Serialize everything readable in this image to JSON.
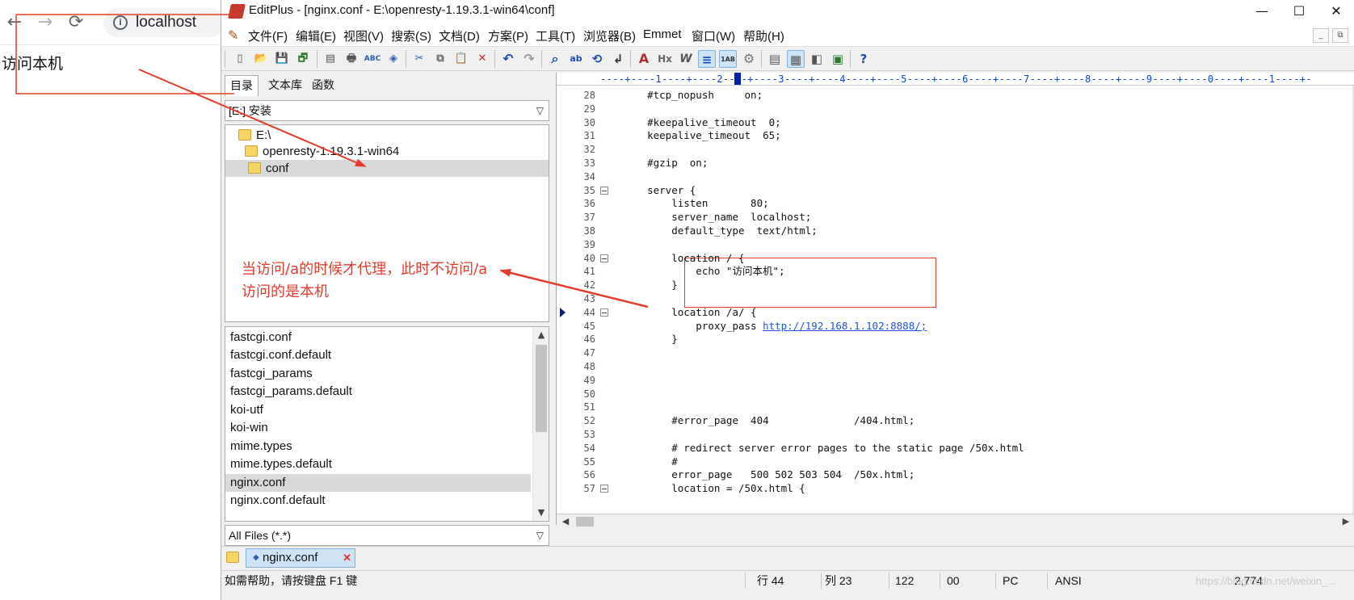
{
  "browser": {
    "back_icon": "←",
    "forward_icon": "→",
    "reload_icon": "⟳",
    "info_icon": "i",
    "url": "localhost",
    "content": "访问本机"
  },
  "window": {
    "title": "EditPlus - [nginx.conf - E:\\openresty-1.19.3.1-win64\\conf]",
    "minimize": "—",
    "maximize": "☐",
    "close": "✕"
  },
  "menu": {
    "pen_icon": "✎",
    "items": [
      "文件(F)",
      "编辑(E)",
      "视图(V)",
      "搜索(S)",
      "文档(D)",
      "方案(P)",
      "工具(T)",
      "浏览器(B)",
      "Emmet",
      "窗口(W)",
      "帮助(H)"
    ],
    "mdi_min": "_",
    "mdi_restore": "⧉"
  },
  "toolbar": {
    "icons": [
      "new-file-icon",
      "open-file-icon",
      "save-icon",
      "save-all-icon",
      "print-preview-icon",
      "print-icon",
      "spellcheck-icon",
      "html-toolbar-icon",
      "cut-icon",
      "copy-icon",
      "paste-icon",
      "delete-icon",
      "undo-icon",
      "redo-icon",
      "find-icon",
      "replace-icon",
      "find-in-files-icon",
      "goto-line-icon",
      "font-icon",
      "hx-icon",
      "word-wrap-icon",
      "indent-icon",
      "line-number-icon",
      "settings-icon",
      "panel-icon",
      "directory-icon",
      "preview-icon",
      "output-icon",
      "help-icon"
    ],
    "glyphs": [
      "▯",
      "📂",
      "💾",
      "🗗",
      "▤",
      "🖶",
      "ABC",
      "◈",
      "✂",
      "⧉",
      "📋",
      "✕",
      "↶",
      "↷",
      "⌕",
      "ab",
      "⟲",
      "↲",
      "A",
      "Hx",
      "W",
      "≡",
      "1AB",
      "⚙",
      "▤",
      "▦",
      "◧",
      "▣",
      "?"
    ]
  },
  "left_panel": {
    "tabs": [
      "目录",
      "文本库",
      "函数"
    ],
    "active_tab": "目录",
    "drive": "[E:] 安装",
    "tree": [
      {
        "label": "E:\\",
        "indent": 0
      },
      {
        "label": "openresty-1.19.3.1-win64",
        "indent": 1
      },
      {
        "label": "conf",
        "indent": 2,
        "selected": true
      }
    ],
    "annotation_line1": "当访问/a的时候才代理，此时不访问/a",
    "annotation_line2": "访问的是本机",
    "files": [
      "fastcgi.conf",
      "fastcgi.conf.default",
      "fastcgi_params",
      "fastcgi_params.default",
      "koi-utf",
      "koi-win",
      "mime.types",
      "mime.types.default",
      "nginx.conf",
      "nginx.conf.default"
    ],
    "selected_file": "nginx.conf",
    "filter": "All Files (*.*)"
  },
  "editor": {
    "ruler": "----+----1----+----2----+----3----+----4----+----5----+----6----+----7----+----8----+----9----+----0----+----1----+-",
    "current_line": 44,
    "lines": [
      {
        "n": "28",
        "t": "    #tcp_nopush     on;"
      },
      {
        "n": "29",
        "t": ""
      },
      {
        "n": "30",
        "t": "    #keepalive_timeout  0;"
      },
      {
        "n": "31",
        "t": "    keepalive_timeout  65;"
      },
      {
        "n": "32",
        "t": ""
      },
      {
        "n": "33",
        "t": "    #gzip  on;"
      },
      {
        "n": "34",
        "t": ""
      },
      {
        "n": "35",
        "t": "    server {",
        "fold": true
      },
      {
        "n": "36",
        "t": "        listen       80;"
      },
      {
        "n": "37",
        "t": "        server_name  localhost;"
      },
      {
        "n": "38",
        "t": "        default_type  text/html;"
      },
      {
        "n": "39",
        "t": ""
      },
      {
        "n": "40",
        "t": "        location / {",
        "fold": true
      },
      {
        "n": "41",
        "t": "            echo \"访问本机\";"
      },
      {
        "n": "42",
        "t": "        }"
      },
      {
        "n": "43",
        "t": ""
      },
      {
        "n": "44",
        "t": "        location /a/ {",
        "fold": true,
        "marker": true
      },
      {
        "n": "45",
        "t": "            proxy_pass ",
        "link": "http://192.168.1.102:8888/;"
      },
      {
        "n": "46",
        "t": "        }"
      },
      {
        "n": "47",
        "t": ""
      },
      {
        "n": "48",
        "t": ""
      },
      {
        "n": "49",
        "t": ""
      },
      {
        "n": "50",
        "t": ""
      },
      {
        "n": "51",
        "t": ""
      },
      {
        "n": "52",
        "t": "        #error_page  404              /404.html;"
      },
      {
        "n": "53",
        "t": ""
      },
      {
        "n": "54",
        "t": "        # redirect server error pages to the static page /50x.html"
      },
      {
        "n": "55",
        "t": "        #"
      },
      {
        "n": "56",
        "t": "        error_page   500 502 503 504  /50x.html;"
      },
      {
        "n": "57",
        "t": "        location = /50x.html {",
        "fold": true
      }
    ]
  },
  "doc_tabs": {
    "items": [
      {
        "label": "nginx.conf",
        "active": true
      }
    ],
    "close_icon": "✕"
  },
  "status": {
    "help": "如需帮助，请按键盘 F1 键",
    "line": "行 44",
    "col": "列 23",
    "total": "122",
    "sel": "00",
    "mode": "PC",
    "encoding": "ANSI",
    "size": "2,774",
    "watermark": "https://blog.csdn.net/weixin_..."
  },
  "colors": {
    "annotation": "#e53b2b",
    "link": "#1e56d6",
    "ruler": "#1144cc"
  }
}
